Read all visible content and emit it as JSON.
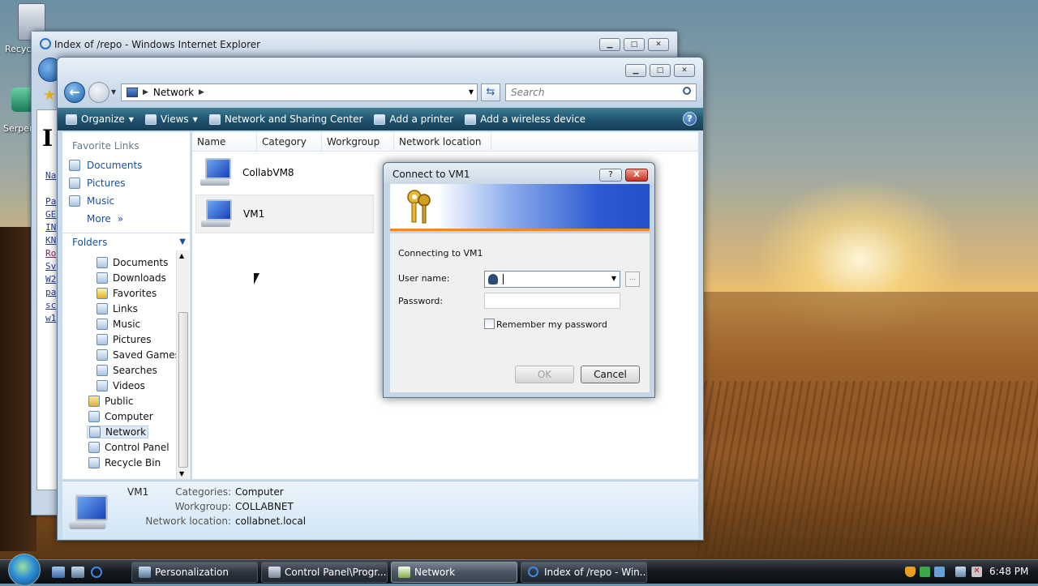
{
  "desktop": {
    "recycle_label": "Recyc",
    "serpent_label": "Serper"
  },
  "ie_window": {
    "title": "Index of /repo - Windows Internet Explorer",
    "heading": "I",
    "links": [
      "Na",
      "Pa",
      "GE",
      "IN",
      "KN",
      "Ro",
      "Sv",
      "W2",
      "pa",
      "sc",
      "w1"
    ]
  },
  "explorer": {
    "address": {
      "location": "Network"
    },
    "search_placeholder": "Search",
    "toolbar": {
      "organize": "Organize",
      "views": "Views",
      "network_sharing": "Network and Sharing Center",
      "add_printer": "Add a printer",
      "add_wireless": "Add a wireless device"
    },
    "favorite_links_header": "Favorite Links",
    "favorite_links": [
      "Documents",
      "Pictures",
      "Music"
    ],
    "more": "More",
    "folders_header": "Folders",
    "folders": [
      "Documents",
      "Downloads",
      "Favorites",
      "Links",
      "Music",
      "Pictures",
      "Saved Games",
      "Searches",
      "Videos",
      "Public",
      "Computer",
      "Network",
      "Control Panel",
      "Recycle Bin"
    ],
    "selected_folder": "Network",
    "columns": [
      "Name",
      "Category",
      "Workgroup",
      "Network location"
    ],
    "items": [
      "CollabVM8",
      "VM1"
    ],
    "details": {
      "name": "VM1",
      "categories_label": "Categories:",
      "categories_value": "Computer",
      "workgroup_label": "Workgroup:",
      "workgroup_value": "COLLABNET",
      "network_location_label": "Network location:",
      "network_location_value": "collabnet.local"
    }
  },
  "dialog": {
    "title": "Connect to VM1",
    "help_glyph": "?",
    "close_glyph": "X",
    "connecting_text": "Connecting to VM1",
    "username_label": "User name:",
    "username_value": "",
    "password_label": "Password:",
    "remember_label": "Remember my password",
    "remember_checked": false,
    "ok_label": "OK",
    "cancel_label": "Cancel",
    "browse_label": "..."
  },
  "taskbar": {
    "tasks": [
      "Personalization",
      "Control Panel\\Progr...",
      "Network",
      "Index of /repo - Win..."
    ],
    "active_task": "Network",
    "clock": "6:48 PM"
  },
  "colors": {
    "toolbar": "#1f5470",
    "selection": "#dfe9f5",
    "link": "#1a4fa0",
    "banner_accent": "#f08a24"
  }
}
